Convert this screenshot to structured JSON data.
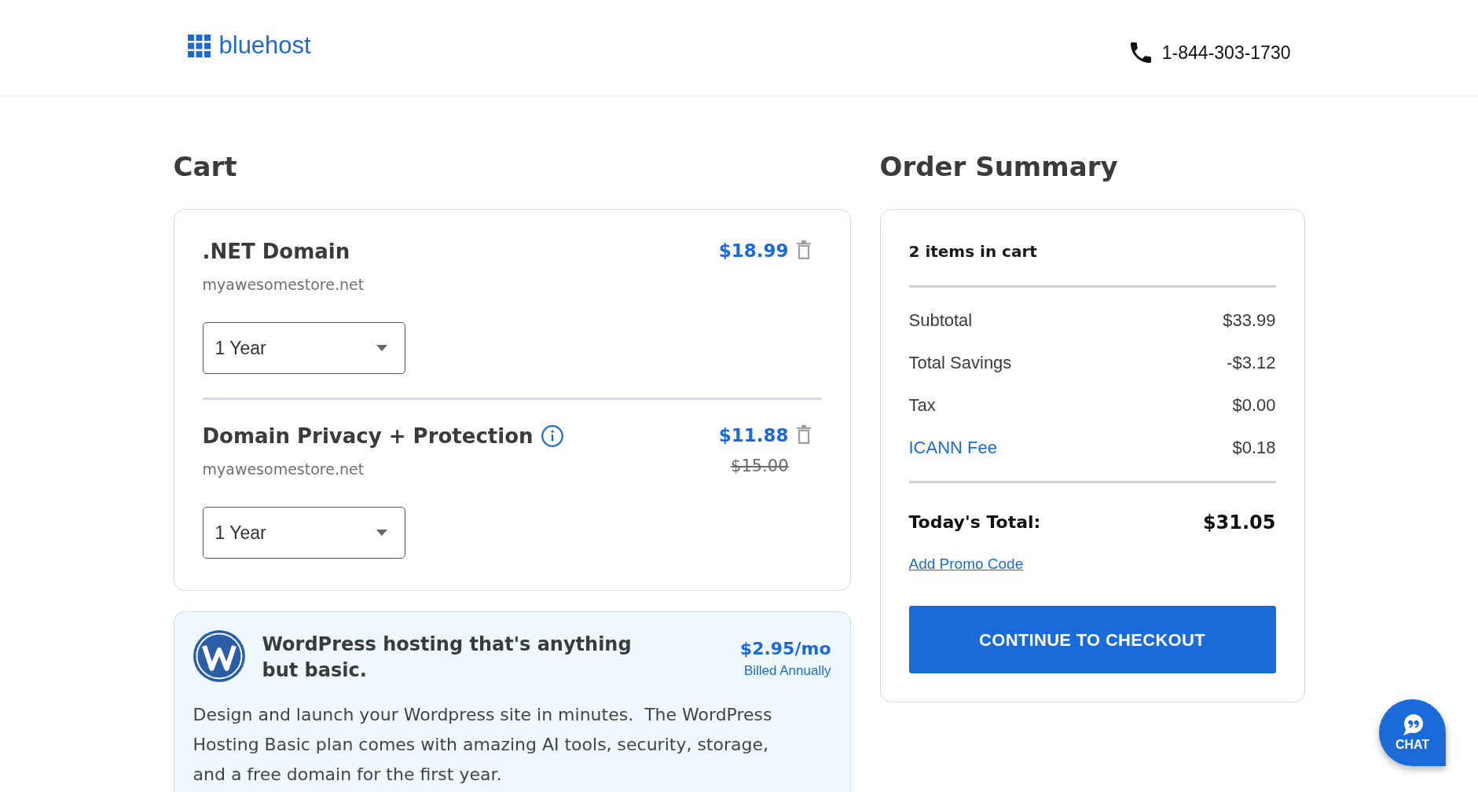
{
  "header": {
    "logo_text": "bluehost",
    "phone": "1-844-303-1730"
  },
  "cart": {
    "title": "Cart",
    "items": [
      {
        "name": ".NET Domain",
        "info": false,
        "domain": "myawesomestore.net",
        "price": "$18.99",
        "term": "1 Year"
      },
      {
        "name": "Domain Privacy + Protection",
        "info": true,
        "domain": "myawesomestore.net",
        "price": "$11.88",
        "original_price": "$15.00",
        "term": "1 Year"
      }
    ],
    "upsell": {
      "title": "WordPress hosting that's anything but basic.",
      "price": "$2.95/mo",
      "billing": "Billed Annually",
      "description": "Design and launch your Wordpress site in minutes.  The WordPress Hosting Basic plan comes with amazing AI tools, security, storage, and a free domain for the first year."
    }
  },
  "order_summary": {
    "title": "Order Summary",
    "item_count": "2 items in cart",
    "lines": [
      {
        "kind": "text",
        "label": "Subtotal",
        "value": "$33.99"
      },
      {
        "kind": "text",
        "label": "Total Savings",
        "value": "-$3.12"
      },
      {
        "kind": "text",
        "label": "Tax",
        "value": "$0.00"
      },
      {
        "kind": "link",
        "label": "ICANN Fee",
        "value": "$0.18"
      }
    ],
    "total": {
      "label": "Today's Total:",
      "value": "$31.05"
    },
    "promo_link": "Add Promo Code",
    "checkout_button": "CONTINUE TO CHECKOUT"
  },
  "chat_button": {
    "label": "CHAT"
  }
}
